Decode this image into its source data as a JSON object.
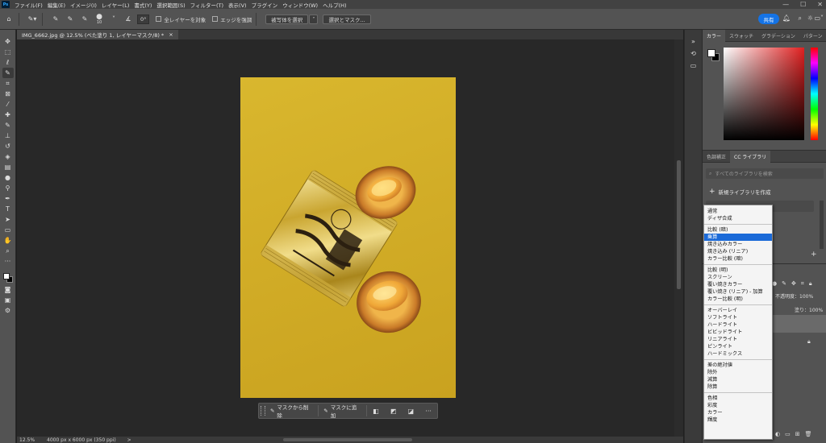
{
  "app": {
    "logo": "Ps"
  },
  "menu": [
    "ファイル(F)",
    "編集(E)",
    "イメージ(I)",
    "レイヤー(L)",
    "書式(Y)",
    "選択範囲(S)",
    "フィルター(T)",
    "表示(V)",
    "プラグイン",
    "ウィンドウ(W)",
    "ヘルプ(H)"
  ],
  "options": {
    "brush_size": "10",
    "angle": "0°",
    "sample_all_layers": "全レイヤーを対象",
    "enhance_edge": "エッジを強調",
    "select_subject": "被写体を選択",
    "select_and_mask": "選択とマスク...",
    "share": "共有"
  },
  "document": {
    "tab_title": "IMG_6662.jpg @ 12.5% (べた塗り 1, レイヤーマスク/8) *",
    "close": "×"
  },
  "taskbar": {
    "subtract": "マスクから削除",
    "add": "マスクに追加",
    "more": "···"
  },
  "status": {
    "zoom": "12.5%",
    "info": "4000 px x 6000 px (350 ppi)",
    "arrow": ">"
  },
  "color_panel": {
    "tabs": [
      "カラー",
      "スウォッチ",
      "グラデーション",
      "パターン"
    ]
  },
  "cc_panel": {
    "tabs": [
      "色調補正",
      "CC ライブラリ"
    ],
    "search_placeholder": "すべてのライブラリを検索",
    "create_library": "新規ライブラリを作成",
    "plus": "+"
  },
  "layers_panel": {
    "opacity": "不透明度：100%",
    "fill": "塗り：100%"
  },
  "blend_modes": {
    "selected": "乗算",
    "groups": [
      [
        "通常",
        "ディザ合成"
      ],
      [
        "比較 (暗)",
        "乗算",
        "焼き込みカラー",
        "焼き込み (リニア)",
        "カラー比較 (暗)"
      ],
      [
        "比較 (明)",
        "スクリーン",
        "覆い焼きカラー",
        "覆い焼き (リニア) - 加算",
        "カラー比較 (明)"
      ],
      [
        "オーバーレイ",
        "ソフトライト",
        "ハードライト",
        "ビビッドライト",
        "リニアライト",
        "ピンライト",
        "ハードミックス"
      ],
      [
        "差の絶対値",
        "除外",
        "減算",
        "除算"
      ],
      [
        "色相",
        "彩度",
        "カラー",
        "輝度"
      ]
    ]
  },
  "colors": {
    "accent": "#1473e6",
    "selection": "#1b6ad8",
    "canvas_yellow": "#d4af29"
  }
}
